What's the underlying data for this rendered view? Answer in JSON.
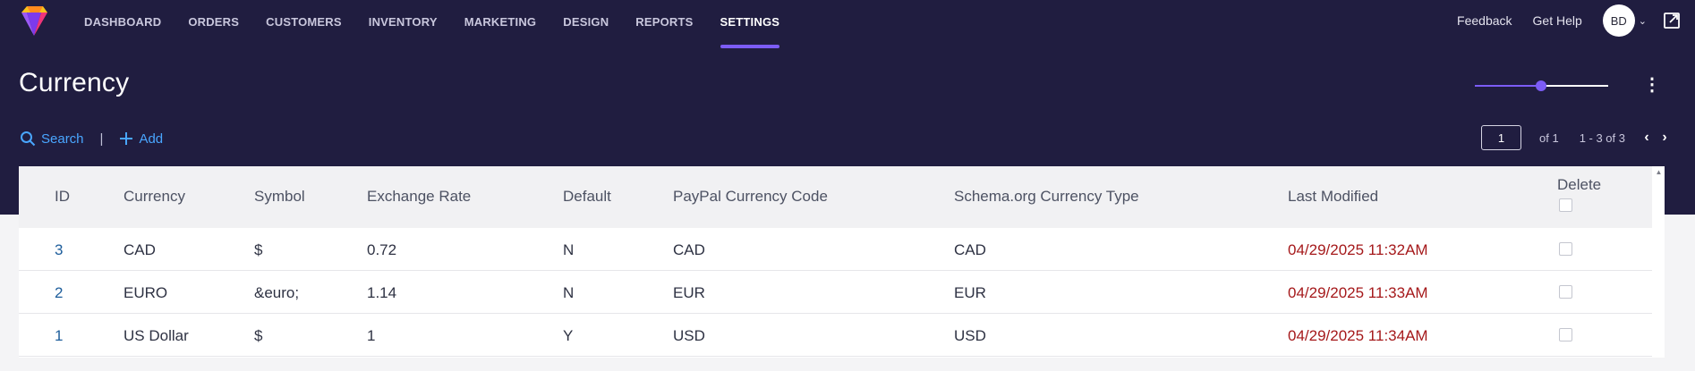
{
  "nav": {
    "items": [
      {
        "label": "DASHBOARD",
        "active": false
      },
      {
        "label": "ORDERS",
        "active": false
      },
      {
        "label": "CUSTOMERS",
        "active": false
      },
      {
        "label": "INVENTORY",
        "active": false
      },
      {
        "label": "MARKETING",
        "active": false
      },
      {
        "label": "DESIGN",
        "active": false
      },
      {
        "label": "REPORTS",
        "active": false
      },
      {
        "label": "SETTINGS",
        "active": true
      }
    ],
    "feedback": "Feedback",
    "help": "Get Help",
    "user_initials": "BD"
  },
  "page": {
    "title": "Currency",
    "density_slider_level": 0.5
  },
  "toolbar": {
    "search_label": "Search",
    "add_label": "Add"
  },
  "pager": {
    "page": "1",
    "of_label": "of 1",
    "range_label": "1 - 3 of 3"
  },
  "table": {
    "headers": {
      "id": "ID",
      "currency": "Currency",
      "symbol": "Symbol",
      "rate": "Exchange Rate",
      "default": "Default",
      "paypal": "PayPal Currency Code",
      "schema": "Schema.org Currency Type",
      "modified": "Last Modified",
      "delete": "Delete"
    },
    "rows": [
      {
        "id": "3",
        "currency": "CAD",
        "symbol": "$",
        "rate": "0.72",
        "default": "N",
        "paypal": "CAD",
        "schema": "CAD",
        "modified": "04/29/2025 11:32AM"
      },
      {
        "id": "2",
        "currency": "EURO",
        "symbol": "&euro;",
        "rate": "1.14",
        "default": "N",
        "paypal": "EUR",
        "schema": "EUR",
        "modified": "04/29/2025 11:33AM"
      },
      {
        "id": "1",
        "currency": "US Dollar",
        "symbol": "$",
        "rate": "1",
        "default": "Y",
        "paypal": "USD",
        "schema": "USD",
        "modified": "04/29/2025 11:34AM"
      }
    ]
  },
  "colors": {
    "header_bg": "#201d40",
    "accent": "#7c5cf6",
    "link": "#49a6ff",
    "id_link": "#1d5d9b",
    "date_red": "#a5191b"
  },
  "icons": {
    "logo": "brand-logo-icon",
    "external": "external-link-icon",
    "search": "search-icon",
    "add": "plus-icon",
    "menu": "kebab-menu-icon",
    "prev": "chevron-left-icon",
    "next": "chevron-right-icon",
    "user_menu": "chevron-down-icon"
  }
}
